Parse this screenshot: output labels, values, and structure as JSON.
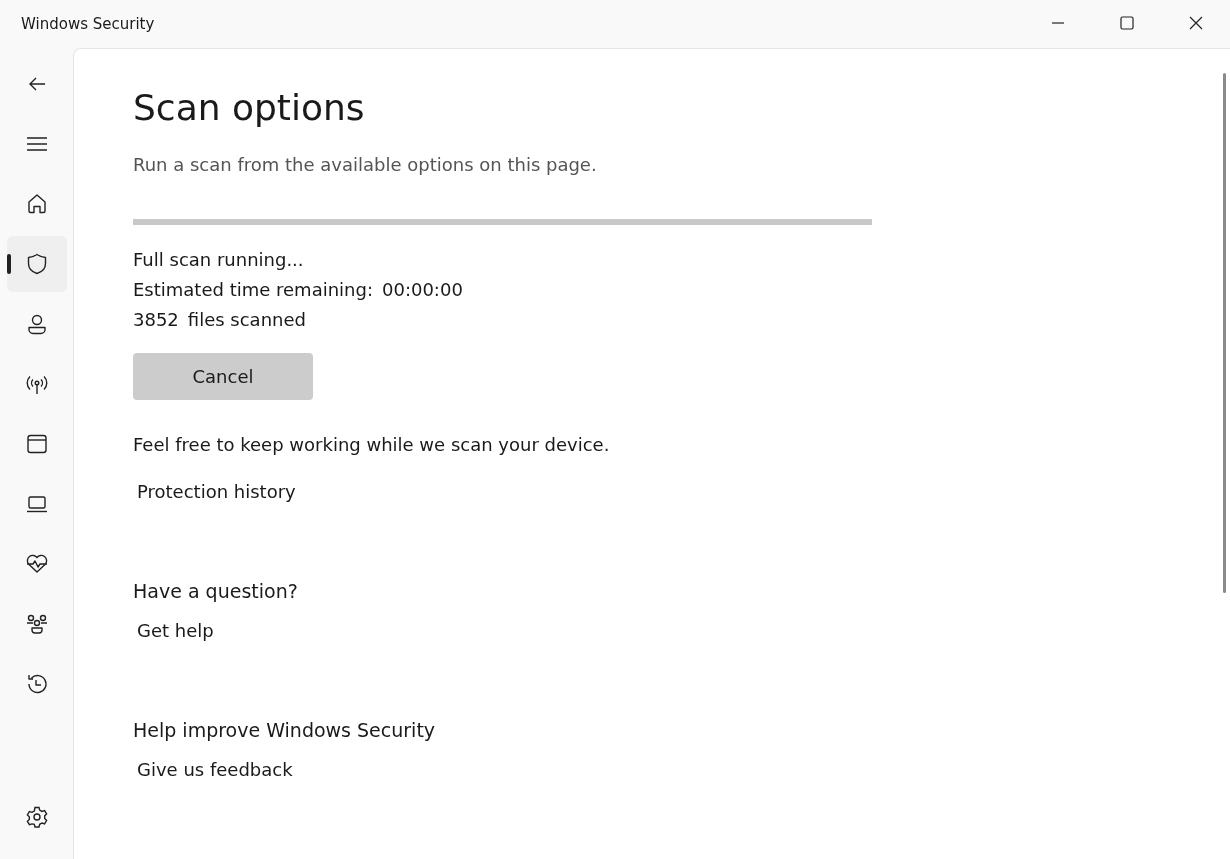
{
  "window": {
    "title": "Windows Security"
  },
  "sidebar": {
    "items": [
      {
        "kind": "home",
        "selected": false
      },
      {
        "kind": "shield",
        "selected": true
      },
      {
        "kind": "account",
        "selected": false
      },
      {
        "kind": "network",
        "selected": false
      },
      {
        "kind": "app",
        "selected": false
      },
      {
        "kind": "device",
        "selected": false
      },
      {
        "kind": "health",
        "selected": false
      },
      {
        "kind": "family",
        "selected": false
      },
      {
        "kind": "history",
        "selected": false
      }
    ]
  },
  "page": {
    "title": "Scan options",
    "subtitle": "Run a scan from the available options on this page.",
    "progress": {
      "level": 1
    },
    "status": "Full scan running...",
    "time_label": "Estimated time remaining:",
    "time_value": "00:00:00",
    "files_count": "3852",
    "files_label": "files scanned",
    "cancel_button": "Cancel",
    "note": "Feel free to keep working while we scan your device.",
    "history_link": "Protection history"
  },
  "help": {
    "heading": "Have a question?",
    "link": "Get help"
  },
  "feedback": {
    "heading": "Help improve Windows Security",
    "link": "Give us feedback"
  }
}
